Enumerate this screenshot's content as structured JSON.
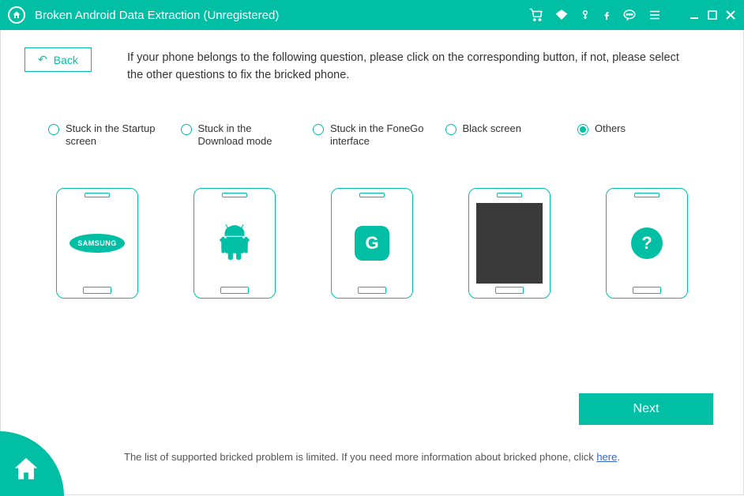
{
  "titlebar": {
    "title": "Broken Android Data Extraction (Unregistered)"
  },
  "back_label": "Back",
  "instructions": "If your phone belongs to the following question, please click on the corresponding button, if not, please select the other questions to fix the bricked phone.",
  "options": [
    {
      "label": "Stuck in the Startup screen",
      "selected": false
    },
    {
      "label": "Stuck in the Download mode",
      "selected": false
    },
    {
      "label": "Stuck in the FoneGo interface",
      "selected": false
    },
    {
      "label": "Black screen",
      "selected": false
    },
    {
      "label": "Others",
      "selected": true
    }
  ],
  "phone_icons": {
    "samsung_label": "SAMSUNG",
    "fonego_label": "G",
    "question_label": "?"
  },
  "next_label": "Next",
  "footer": {
    "text_before": "The list of supported bricked problem is limited. If you need more information about bricked phone, click ",
    "link_text": "here",
    "text_after": "."
  }
}
